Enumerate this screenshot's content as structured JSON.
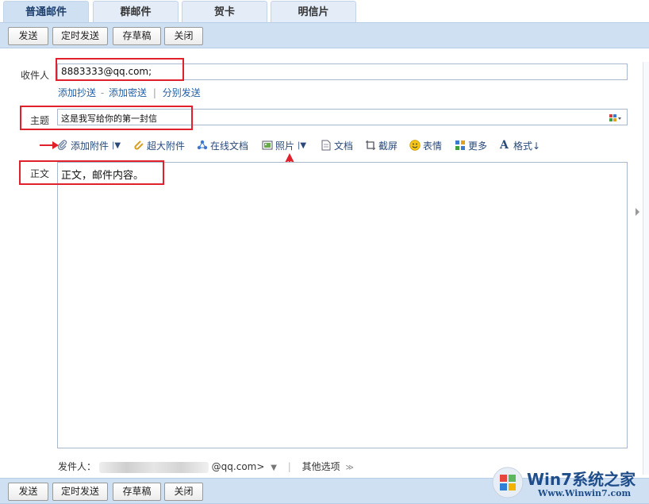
{
  "tabs": [
    {
      "label": "普通邮件",
      "active": true
    },
    {
      "label": "群邮件",
      "active": false
    },
    {
      "label": "贺卡",
      "active": false
    },
    {
      "label": "明信片",
      "active": false
    }
  ],
  "toolbar": {
    "send": "发送",
    "scheduled_send": "定时发送",
    "save_draft": "存草稿",
    "close": "关闭"
  },
  "form": {
    "recipient_label": "收件人",
    "recipient_value": "8883333@qq.com;",
    "cc_links": {
      "add_cc": "添加抄送",
      "dash": "-",
      "add_bcc": "添加密送",
      "separate_send": "分别发送"
    },
    "subject_label": "主题",
    "subject_value": "这是我写给你的第一封信",
    "body_label": "正文",
    "body_value": "正文，邮件内容。"
  },
  "attach_tools": {
    "add_attachment": "添加附件",
    "large_attachment": "超大附件",
    "online_doc": "在线文档",
    "photo": "照片",
    "document": "文档",
    "screenshot": "截屏",
    "emoji": "表情",
    "more": "更多",
    "format": "格式↓"
  },
  "sender": {
    "label": "发件人：",
    "email_suffix": "@qq.com>",
    "other_options": "其他选项"
  },
  "watermark": {
    "brand": "Win7系统之家",
    "url": "Www.Winwin7.com"
  },
  "colors": {
    "annotation_red": "#e0202a",
    "toolbar_bg": "#cfe0f3",
    "link_blue": "#2060a8"
  }
}
